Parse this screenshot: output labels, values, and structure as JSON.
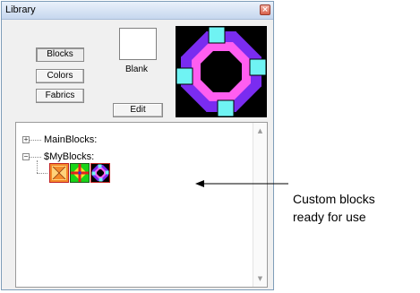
{
  "window": {
    "title": "Library",
    "close_glyph": "×"
  },
  "buttons": {
    "blocks": "Blocks",
    "colors": "Colors",
    "fabrics": "Fabrics",
    "edit": "Edit"
  },
  "preview": {
    "blank_label": "Blank"
  },
  "tree": {
    "nodes": [
      {
        "label": "MainBlocks:",
        "expander": "+"
      },
      {
        "label": "$MyBlocks:",
        "expander": "−"
      }
    ],
    "thumbnails": [
      "hourglass-block-icon",
      "cross-block-icon",
      "ring-block-icon"
    ]
  },
  "annotation": {
    "line1": "Custom blocks",
    "line2": "ready for use"
  },
  "colors": {
    "purple": "#7a2cf0",
    "pink": "#ff5ef0",
    "cyan": "#6ff3f3",
    "green": "#18d418",
    "orange": "#f38a2a",
    "red": "#e02020"
  }
}
